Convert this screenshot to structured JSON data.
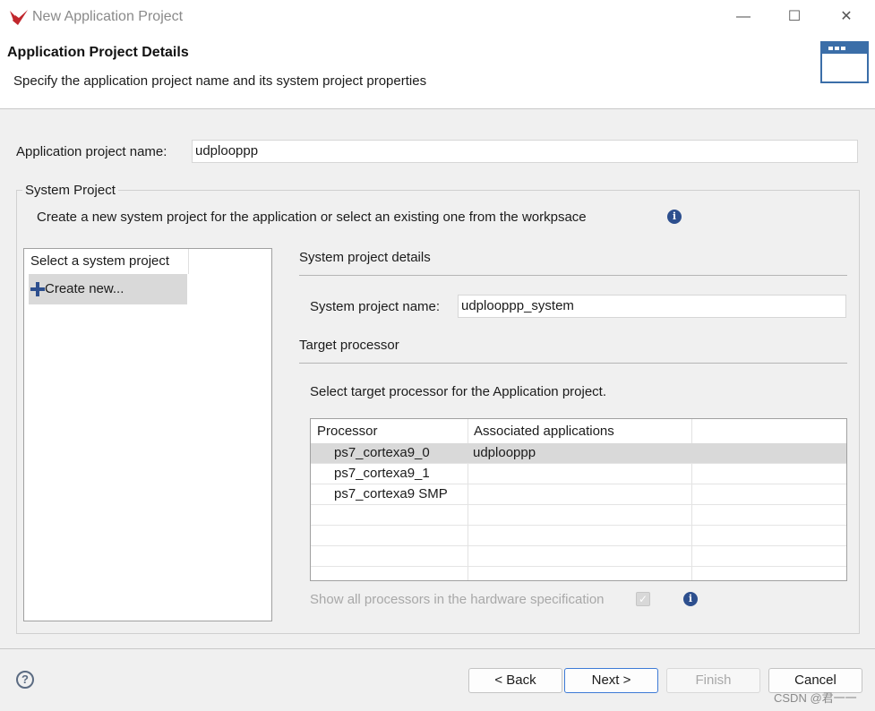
{
  "window": {
    "title": "New Application Project",
    "controls": {
      "minimize": "—",
      "maximize": "☐",
      "close": "✕"
    }
  },
  "header": {
    "title": "Application Project Details",
    "description": "Specify the application project name and its system project properties"
  },
  "form": {
    "app_name_label": "Application project name:",
    "app_name_value": "udplooppp"
  },
  "system_project": {
    "group_title": "System Project",
    "description": "Create a new system project for the application or select an existing one from the workpsace",
    "list_header": "Select a system project",
    "list_items": [
      {
        "label": "Create new...",
        "icon": "plus-icon",
        "selected": true
      }
    ],
    "details_title": "System project details",
    "name_label": "System project name:",
    "name_value": "udplooppp_system",
    "target_title": "Target processor",
    "target_desc": "Select target processor for the Application project.",
    "table": {
      "headers": [
        "Processor",
        "Associated applications",
        ""
      ],
      "rows": [
        {
          "processor": "ps7_cortexa9_0",
          "apps": "udplooppp",
          "selected": true
        },
        {
          "processor": "ps7_cortexa9_1",
          "apps": "",
          "selected": false
        },
        {
          "processor": "ps7_cortexa9 SMP",
          "apps": "",
          "selected": false
        },
        {
          "processor": "",
          "apps": "",
          "selected": false
        },
        {
          "processor": "",
          "apps": "",
          "selected": false
        },
        {
          "processor": "",
          "apps": "",
          "selected": false
        }
      ]
    },
    "show_all_label": "Show all processors in the hardware specification",
    "show_all_checked": true
  },
  "footer": {
    "help_icon": "?",
    "back": "< Back",
    "next": "Next >",
    "finish": "Finish",
    "cancel": "Cancel",
    "watermark": "CSDN @君一一"
  },
  "colors": {
    "accent": "#2d4f8e",
    "primary_border": "#3e7bd6",
    "logo": "#c1272d"
  }
}
